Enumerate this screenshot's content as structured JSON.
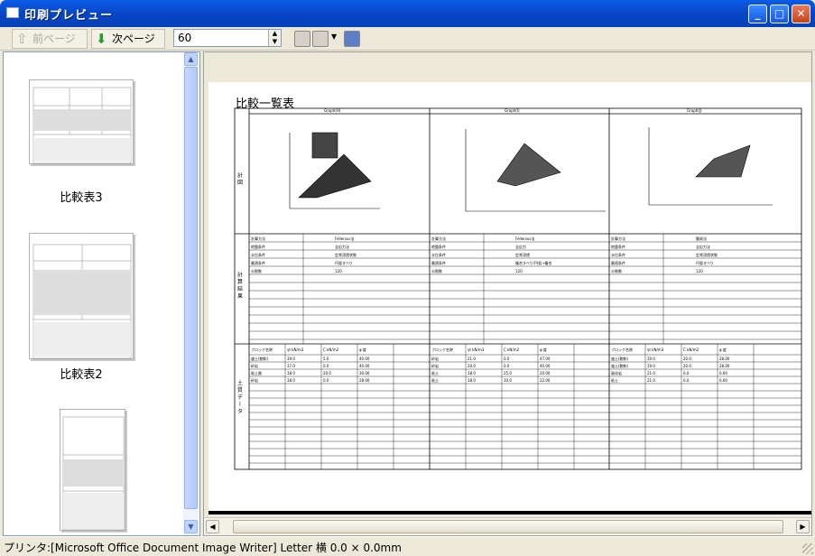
{
  "window": {
    "title": "印刷プレビュー"
  },
  "toolbar": {
    "prev_label": "前ページ",
    "next_label": "次ページ",
    "zoom_value": "60"
  },
  "thumbnails": [
    {
      "label": "比較表3"
    },
    {
      "label": "比較表2"
    },
    {
      "label": ""
    }
  ],
  "document": {
    "title": "比較一覧表",
    "columns": [
      "Graph(H)",
      "Graph(I)",
      "Graph(J)"
    ],
    "row_labels": {
      "figure": "計 図",
      "results": "計 算 結 果",
      "soil": "土 質 デ ー タ"
    },
    "params": [
      [
        "計算方法",
        "Fellenius法",
        "計算方法",
        "Fellenius法",
        "計算方法",
        "簡易法"
      ],
      [
        "地盤条件",
        "全応力法",
        "地盤条件",
        "全応力",
        "地盤条件",
        "全応力法"
      ],
      [
        "水位条件",
        "定常浸透状態",
        "水位条件",
        "定常浸透",
        "水位条件",
        "定常浸透状態"
      ],
      [
        "最適条件",
        "円弧すべり",
        "最適条件",
        "複合すべり/円弧→複合",
        "最適条件",
        "円弧すべり"
      ],
      [
        "分割数",
        "120",
        "分割数",
        "120",
        "分割数",
        "120"
      ]
    ],
    "soil_header": [
      "ブロック名称",
      "γt kN/m3",
      "C kN/m2",
      "φ 度"
    ],
    "soil_rows": [
      [
        [
          "盛土(飽和)",
          "19.0",
          "5.0",
          "40.00"
        ],
        [
          "砂岩",
          "21.0",
          "0.0",
          "47.00"
        ],
        [
          "盛土(飽和)",
          "19.0",
          "20.0",
          "28.00"
        ]
      ],
      [
        [
          "砂岩",
          "17.0",
          "0.0",
          "40.00"
        ],
        [
          "砂岩",
          "20.0",
          "0.0",
          "40.00"
        ],
        [
          "盛土(飽和)",
          "19.0",
          "20.0",
          "28.00"
        ]
      ],
      [
        [
          "粘土層",
          "18.0",
          "20.0",
          "30.00"
        ],
        [
          "粘土",
          "18.0",
          "25.0",
          "20.00"
        ],
        [
          "風化岩",
          "21.0",
          "0.0",
          "0.00"
        ]
      ],
      [
        [
          "砂岩",
          "18.0",
          "0.0",
          "28.00"
        ],
        [
          "粘土",
          "18.0",
          "10.0",
          "22.00"
        ],
        [
          "粘土",
          "21.0",
          "0.0",
          "0.00"
        ]
      ]
    ]
  },
  "status": {
    "text": "プリンタ:[Microsoft Office Document Image Writer] Letter 横   0.0 ×   0.0mm"
  }
}
